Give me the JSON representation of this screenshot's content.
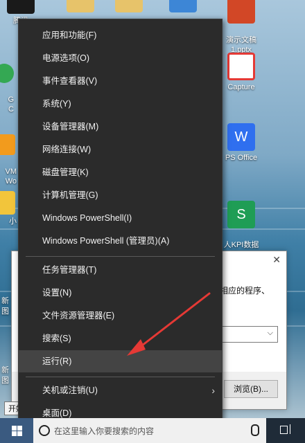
{
  "desktop": {
    "icons": [
      {
        "label": "腾讯",
        "color": "#1a1a1a"
      },
      {
        "label": "",
        "color": "#e7c36a"
      },
      {
        "label": "",
        "color": "#e7c36a"
      },
      {
        "label": "",
        "color": "#3d86d6"
      },
      {
        "label": "演示文稿\n1.pptx",
        "color": "#d24726"
      },
      {
        "label": "G\nC",
        "color": "#34a853"
      },
      {
        "label": "Capture",
        "color": "#e53935"
      },
      {
        "label": "VM\nWo",
        "color": "#f29b1d"
      },
      {
        "label": "PS Office",
        "color": "#2f6fef"
      },
      {
        "label": "小",
        "color": "#f2c53b"
      },
      {
        "label": "人KPI数据\n源.xlsx",
        "color": "#1f9d55"
      }
    ],
    "partial_texts": [
      "新\n图",
      "新\n图"
    ]
  },
  "run_dialog": {
    "description": "相应的程序、",
    "browse_label": "浏览(B)..."
  },
  "tooltip": "开始",
  "winx_menu": {
    "group1": [
      "应用和功能(F)",
      "电源选项(O)",
      "事件查看器(V)",
      "系统(Y)",
      "设备管理器(M)",
      "网络连接(W)",
      "磁盘管理(K)",
      "计算机管理(G)",
      "Windows PowerShell(I)",
      "Windows PowerShell (管理员)(A)"
    ],
    "group2": [
      "任务管理器(T)",
      "设置(N)",
      "文件资源管理器(E)",
      "搜索(S)",
      "运行(R)"
    ],
    "group3": [
      "关机或注销(U)",
      "桌面(D)"
    ],
    "highlighted": "运行(R)",
    "colors": {
      "background": "#2b2b2b",
      "highlight": "#444444",
      "text": "#f2f2f2"
    }
  },
  "annotation": {
    "color": "#e53935"
  },
  "taskbar": {
    "search_placeholder": "在这里输入你要搜索的内容",
    "icons": [
      "windows-logo",
      "search-icon",
      "microphone-icon",
      "task-view-icon"
    ]
  }
}
